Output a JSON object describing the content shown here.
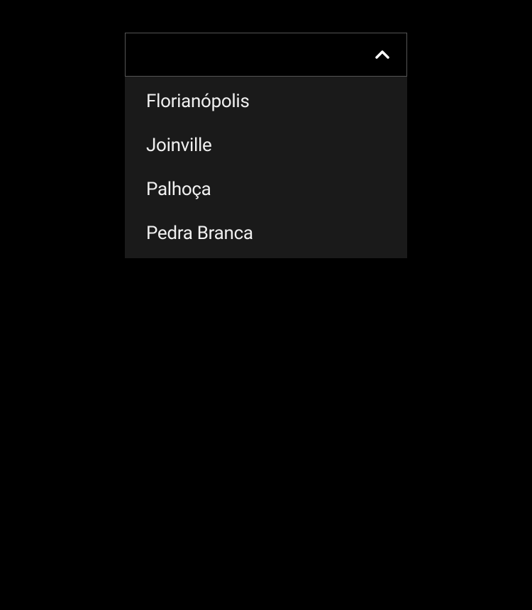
{
  "dropdown": {
    "selected": "",
    "options": {
      "0": {
        "label": "Florianópolis"
      },
      "1": {
        "label": "Joinville"
      },
      "2": {
        "label": "Palhoça"
      },
      "3": {
        "label": "Pedra Branca"
      }
    }
  }
}
